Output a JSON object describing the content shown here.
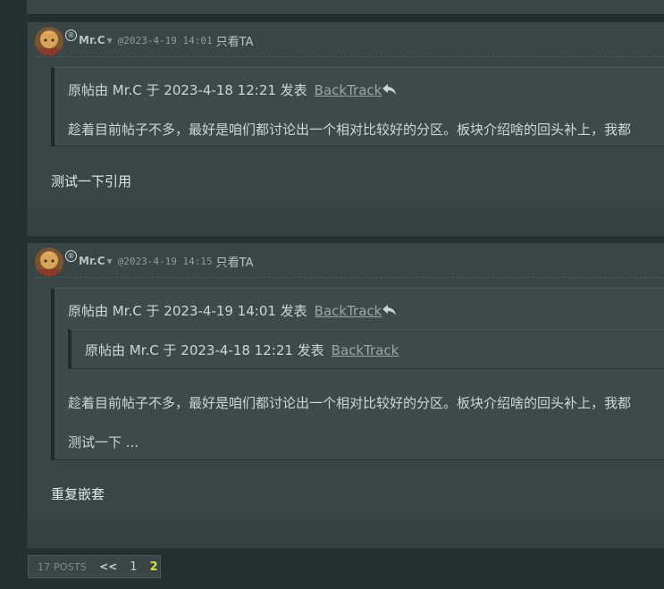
{
  "posts": [
    {
      "username": "Mr.C",
      "timestamp": "@2023-4-19 14:01",
      "only_ta": "只看TA",
      "quote": {
        "source_text": "原帖由 Mr.C 于 2023-4-18 12:21 发表",
        "backtrack": "BackTrack",
        "text": "趁着目前帖子不多，最好是咱们都讨论出一个相对比较好的分区。板块介绍啥的回头补上，我都"
      },
      "body": "测试一下引用"
    },
    {
      "username": "Mr.C",
      "timestamp": "@2023-4-19 14:15",
      "only_ta": "只看TA",
      "quote": {
        "source_text": "原帖由 Mr.C 于 2023-4-19 14:01 发表",
        "backtrack": "BackTrack",
        "nested_source_text": "原帖由 Mr.C 于 2023-4-18 12:21 发表",
        "nested_backtrack": "BackTrack",
        "text": "趁着目前帖子不多，最好是咱们都讨论出一个相对比较好的分区。板块介绍啥的回头补上，我都",
        "text2": "测试一下 ..."
      },
      "body": "重复嵌套"
    }
  ],
  "pager": {
    "posts_count": "17 POSTS",
    "prev": "<<",
    "page1": "1",
    "page2": "2"
  },
  "colors": {
    "background": "#243030",
    "panel": "#3a4646",
    "current_page": "#d5e33a"
  }
}
